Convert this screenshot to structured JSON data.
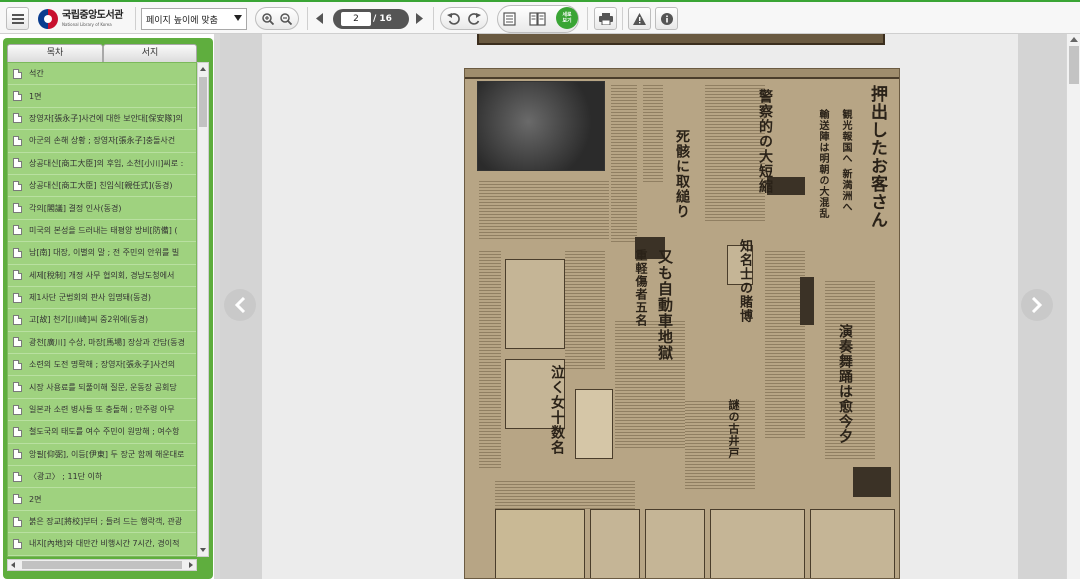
{
  "toolbar": {
    "menu_icon": "hamburger-menu-icon",
    "logo": {
      "name_ko": "국립중앙도서관",
      "name_en": "National Library of Korea"
    },
    "zoom_select": {
      "value": "페이지 높이에 맞춤"
    },
    "zoom_in_icon": "zoom-in-icon",
    "zoom_out_icon": "zoom-out-icon",
    "prev_icon": "triangle-left-icon",
    "next_icon": "triangle-right-icon",
    "page": {
      "current": "2",
      "total": "/ 16"
    },
    "rotate_left_icon": "rotate-left-icon",
    "rotate_right_icon": "rotate-right-icon",
    "single_view_icon": "single-page-icon",
    "double_view_icon": "double-page-icon",
    "vertical_view": {
      "line1": "세로",
      "line2": "보기"
    },
    "print_icon": "printer-icon",
    "warning_icon": "warning-icon",
    "info_icon": "info-icon",
    "accent_color": "#3aa535"
  },
  "sidebar": {
    "tabs": [
      {
        "label": "목차"
      },
      {
        "label": "서지"
      }
    ],
    "items": [
      {
        "label": "석간"
      },
      {
        "label": "1면"
      },
      {
        "label": "장영자[張永子]사건에 대한 보안대[保安隊]의"
      },
      {
        "label": "아군의 손해 상황 ; 장영자[張永子]충돌사건"
      },
      {
        "label": "상공대신[商工大臣]의 후임, 소천[小川]씨로 :"
      },
      {
        "label": "상공대신[商工大臣] 친임식[親任式](동경)"
      },
      {
        "label": "각의[閣議] 결정 인사(동경)"
      },
      {
        "label": "미국의 본성을 드러내는 태평양 방비[防備] ("
      },
      {
        "label": "남[南] 대장, 이별의 말 ; 전 주민의 안위를 빌"
      },
      {
        "label": "세제[稅制] 개정 사무 협의회, 경남도청에서"
      },
      {
        "label": "제1사단 군법회의 판사 임명돼(동경)"
      },
      {
        "label": "고[故] 천기[川崎]씨 중2위에(동경)"
      },
      {
        "label": "광천[廣川] 수상, 마장[馬場] 장상과 간담(동경"
      },
      {
        "label": "소련의 도전 명확해 ; 장영자[張永子]사건의"
      },
      {
        "label": "시장 사용료를 되풀이해 질문, 운동장 공회당"
      },
      {
        "label": "일본과 소련 병사들 또 충돌해 ; 만주령 아무"
      },
      {
        "label": "철도국의 태도를 여수 주민이 원망해 ; 여수항"
      },
      {
        "label": "앙필[仰弼], 이등[伊東] 두 장군 함께 해운대로"
      },
      {
        "label": "〈광고〉 ; 11단 이하"
      },
      {
        "label": "2면"
      },
      {
        "label": "붉은 장교[將校]부터 ; 들려 드는 행락객, 관광"
      },
      {
        "label": "내지[內地]와 대만간 비행시간 7시간, 경이적"
      }
    ]
  },
  "viewer": {
    "prev_arrow_icon": "chevron-left-icon",
    "next_arrow_icon": "chevron-right-icon",
    "newspaper_image": "newspaper-page-scan"
  }
}
